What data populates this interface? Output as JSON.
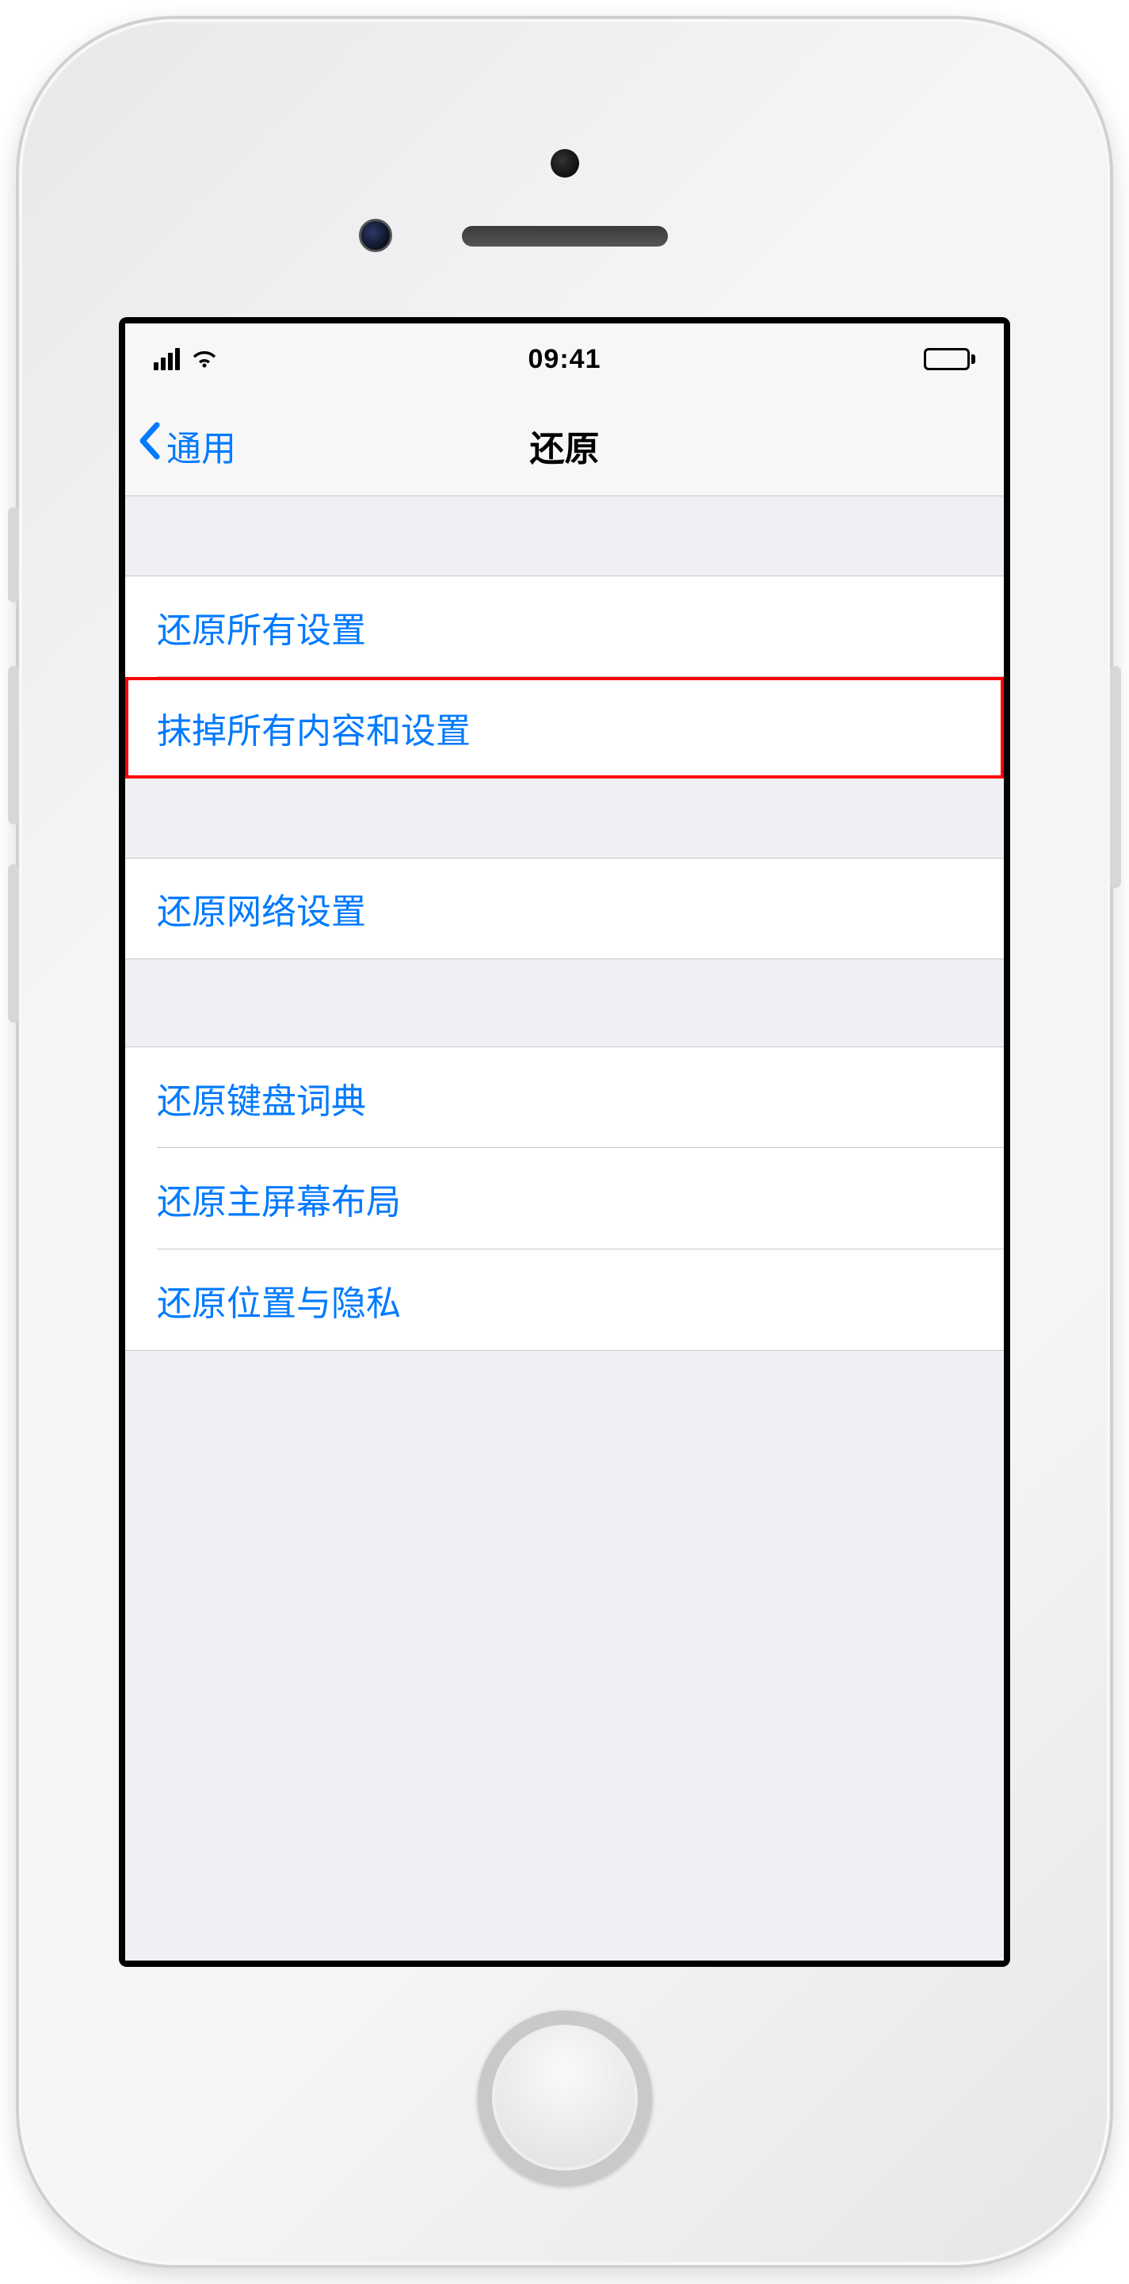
{
  "status": {
    "time": "09:41"
  },
  "nav": {
    "back_label": "通用",
    "title": "还原"
  },
  "rows": {
    "reset_all_settings": "还原所有设置",
    "erase_all_content": "抹掉所有内容和设置",
    "reset_network": "还原网络设置",
    "reset_keyboard_dict": "还原键盘词典",
    "reset_home_layout": "还原主屏幕布局",
    "reset_location_priv": "还原位置与隐私"
  },
  "highlighted_row_key": "erase_all_content",
  "colors": {
    "link": "#007aff",
    "bg": "#efeff4",
    "sep": "#c8c7cc",
    "highlight": "#ff0000"
  }
}
